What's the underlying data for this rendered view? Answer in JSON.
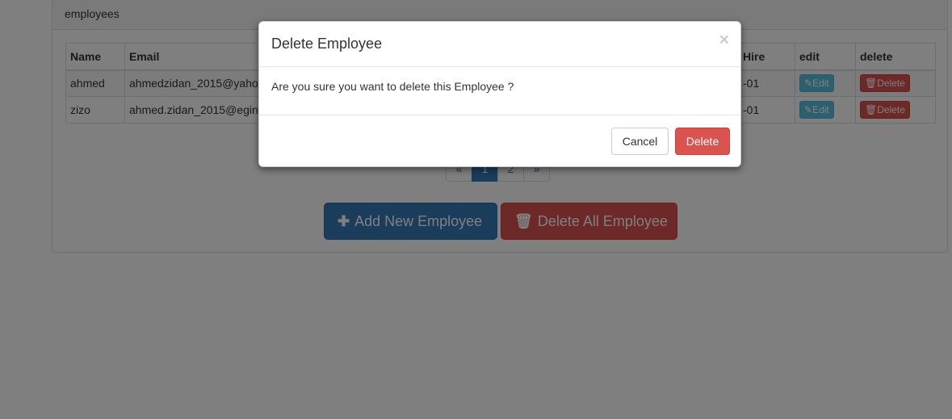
{
  "panel": {
    "heading": "employees"
  },
  "table": {
    "headers": [
      "Name",
      "Email",
      "",
      "Hire",
      "edit",
      "delete"
    ],
    "rows": [
      {
        "name": "ahmed",
        "email": "ahmedzidan_2015@yaho",
        "hire": "-01",
        "edit": "Edit",
        "delete": "Delete"
      },
      {
        "name": "zizo",
        "email": "ahmed.zidan_2015@egin",
        "hire": "-01",
        "edit": "Edit",
        "delete": "Delete"
      }
    ]
  },
  "pagination": {
    "prev": "«",
    "pages": [
      "1",
      "2"
    ],
    "next": "»",
    "active": "1"
  },
  "actions": {
    "add_label": "Add New Employee",
    "add_icon": "plus-icon",
    "delete_all_label": "Delete All Employee",
    "delete_all_icon": "trash-icon"
  },
  "modal": {
    "title": "Delete Employee",
    "close": "×",
    "message": "Are you sure you want to delete this Employee ?",
    "cancel_label": "Cancel",
    "delete_label": "Delete"
  },
  "colors": {
    "primary": "#337ab7",
    "danger": "#d9534f",
    "info": "#5bc0de",
    "backdrop": "rgba(0,0,0,0.5)"
  }
}
